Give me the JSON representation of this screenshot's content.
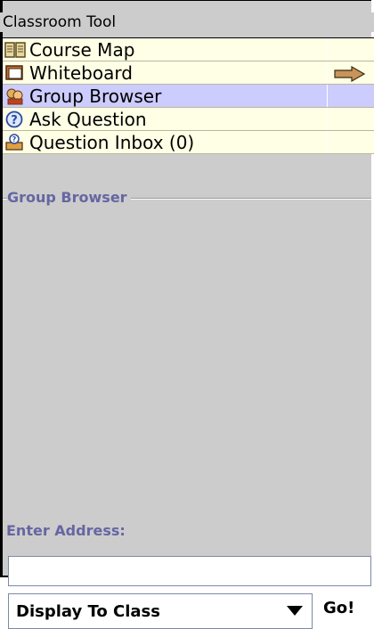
{
  "window": {
    "title": "Classroom Tool"
  },
  "menu": {
    "items": [
      {
        "label": "Course Map",
        "icon": "book-icon"
      },
      {
        "label": "Whiteboard",
        "icon": "whiteboard-icon"
      },
      {
        "label": "Group Browser",
        "icon": "group-icon"
      },
      {
        "label": "Ask Question",
        "icon": "question-icon"
      },
      {
        "label": "Question Inbox (0)",
        "icon": "inbox-icon"
      }
    ],
    "selected_index": 2
  },
  "group_browser": {
    "legend": "Group Browser",
    "address_label": "Enter Address:",
    "address_value": "",
    "display_select": "Display To Class",
    "go_label": "Go!"
  },
  "colors": {
    "menu_bg": "#ffffe6",
    "selected_bg": "#ccccff",
    "panel_bg": "#cccccc",
    "label_color": "#6666a3"
  }
}
